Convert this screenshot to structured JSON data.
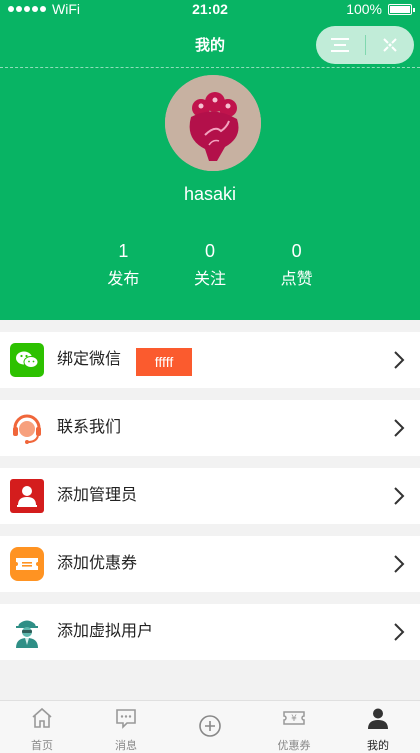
{
  "status_bar": {
    "carrier": "WiFi",
    "time": "21:02",
    "battery": "100%"
  },
  "nav": {
    "title": "我的"
  },
  "profile": {
    "username": "hasaki"
  },
  "stats": [
    {
      "value": "1",
      "label": "发布"
    },
    {
      "value": "0",
      "label": "关注"
    },
    {
      "value": "0",
      "label": "点赞"
    }
  ],
  "menu": [
    {
      "label": "绑定微信",
      "icon": "wechat-icon",
      "badge": "fffff"
    },
    {
      "label": "联系我们",
      "icon": "customer-service-icon"
    },
    {
      "label": "添加管理员",
      "icon": "admin-icon"
    },
    {
      "label": "添加优惠券",
      "icon": "coupon-icon"
    },
    {
      "label": "添加虚拟用户",
      "icon": "virtual-user-icon"
    }
  ],
  "tabs": [
    {
      "label": "首页",
      "icon": "home-icon"
    },
    {
      "label": "消息",
      "icon": "message-icon"
    },
    {
      "label": "",
      "icon": "add-icon"
    },
    {
      "label": "优惠券",
      "icon": "ticket-icon"
    },
    {
      "label": "我的",
      "icon": "user-icon",
      "active": true
    }
  ],
  "colors": {
    "header_green": "#08b464",
    "badge_orange": "#fb5b2e"
  }
}
